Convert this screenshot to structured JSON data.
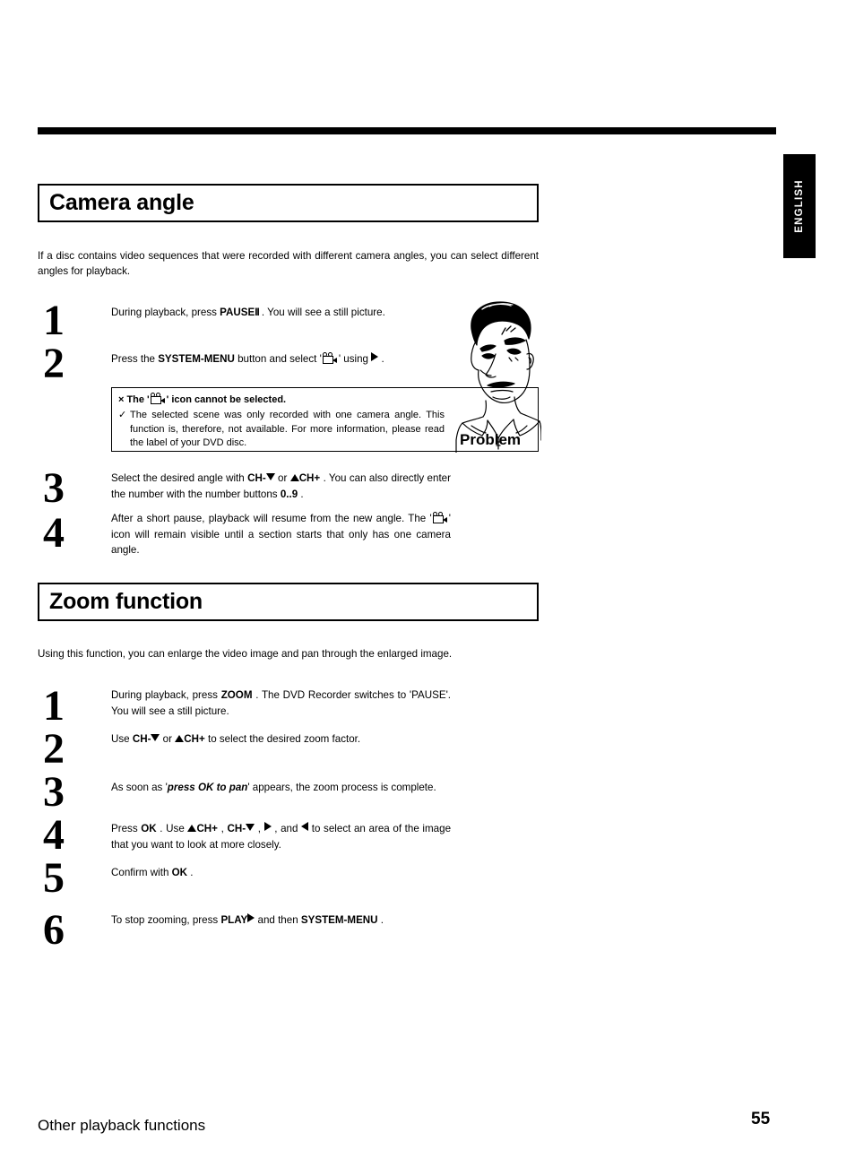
{
  "document": {
    "language_tab": "ENGLISH",
    "footer_section": "Other playback functions",
    "page_number": "55"
  },
  "sections": [
    {
      "id": "camera-angle",
      "heading": "Camera angle",
      "intro": "If a disc contains video sequences that were recorded with different camera angles, you can select different angles for playback.",
      "steps": [
        {
          "number": "1",
          "segments": [
            {
              "t": "text",
              "v": "During playback, press "
            },
            {
              "t": "key",
              "v": "PAUSE"
            },
            {
              "t": "pause-icon",
              "v": "II"
            },
            {
              "t": "text",
              "v": " . You will see a still picture."
            }
          ]
        },
        {
          "number": "2",
          "segments": [
            {
              "t": "text",
              "v": "Press the "
            },
            {
              "t": "key",
              "v": "SYSTEM-MENU"
            },
            {
              "t": "text",
              "v": " button and select '"
            },
            {
              "t": "camera-icon",
              "v": "camera-angle-icon"
            },
            {
              "t": "text",
              "v": "' using "
            },
            {
              "t": "arrow-right",
              "v": "▶"
            },
            {
              "t": "text",
              "v": " ."
            }
          ]
        },
        {
          "number": "3",
          "segments": [
            {
              "t": "text",
              "v": "Select the desired angle with "
            },
            {
              "t": "key",
              "v": "CH-"
            },
            {
              "t": "arrow-down",
              "v": "▼"
            },
            {
              "t": "text",
              "v": " or "
            },
            {
              "t": "arrow-up",
              "v": "▲"
            },
            {
              "t": "key",
              "v": "CH+"
            },
            {
              "t": "text",
              "v": " . You can also directly enter the number with the number buttons "
            },
            {
              "t": "key",
              "v": "0..9"
            },
            {
              "t": "text",
              "v": " ."
            }
          ]
        },
        {
          "number": "4",
          "segments": [
            {
              "t": "text",
              "v": "After a short pause, playback will resume from the new angle. The '"
            },
            {
              "t": "camera-icon",
              "v": "camera-angle-icon"
            },
            {
              "t": "text",
              "v": "' icon will remain visible until a section starts that only has one camera angle."
            }
          ]
        }
      ],
      "notice": {
        "problem_bullet": "×",
        "problem_prefix": "The '",
        "problem_icon": "camera-angle-icon",
        "problem_suffix": "' icon cannot be selected.",
        "solution_bullet": "✓",
        "solution_text": "The selected scene was only recorded with one camera angle. This function is, therefore, not available. For more information, please read the label of your DVD disc."
      },
      "illustration_label": "Problem",
      "illustration_name": "frustrated-man-drawing"
    },
    {
      "id": "zoom-function",
      "heading": "Zoom function",
      "intro": "Using this function, you can enlarge the video image and pan through the enlarged image.",
      "steps": [
        {
          "number": "1",
          "segments": [
            {
              "t": "text",
              "v": "During playback, press "
            },
            {
              "t": "key",
              "v": "ZOOM"
            },
            {
              "t": "text",
              "v": " . The DVD Recorder switches to 'PAUSE'. You will see a still picture."
            }
          ]
        },
        {
          "number": "2",
          "segments": [
            {
              "t": "text",
              "v": "Use "
            },
            {
              "t": "key",
              "v": "CH-"
            },
            {
              "t": "arrow-down",
              "v": "▼"
            },
            {
              "t": "text",
              "v": " or "
            },
            {
              "t": "arrow-up",
              "v": "▲"
            },
            {
              "t": "key",
              "v": "CH+"
            },
            {
              "t": "text",
              "v": " to select the desired zoom factor."
            }
          ]
        },
        {
          "number": "3",
          "segments": [
            {
              "t": "text",
              "v": "As soon as '"
            },
            {
              "t": "emph",
              "v": "press OK to pan"
            },
            {
              "t": "text",
              "v": "' appears, the zoom process is complete."
            }
          ]
        },
        {
          "number": "4",
          "segments": [
            {
              "t": "text",
              "v": "Press "
            },
            {
              "t": "key",
              "v": "OK"
            },
            {
              "t": "text",
              "v": " . Use "
            },
            {
              "t": "arrow-up",
              "v": "▲"
            },
            {
              "t": "key",
              "v": "CH+"
            },
            {
              "t": "text",
              "v": " , "
            },
            {
              "t": "key",
              "v": "CH-"
            },
            {
              "t": "arrow-down",
              "v": "▼"
            },
            {
              "t": "text",
              "v": " , "
            },
            {
              "t": "arrow-right",
              "v": "▶"
            },
            {
              "t": "text",
              "v": " , and "
            },
            {
              "t": "arrow-left",
              "v": "◀"
            },
            {
              "t": "text",
              "v": " to select an area of the image that you want to look at more closely."
            }
          ]
        },
        {
          "number": "5",
          "segments": [
            {
              "t": "text",
              "v": "Confirm with "
            },
            {
              "t": "key",
              "v": "OK"
            },
            {
              "t": "text",
              "v": " ."
            }
          ]
        },
        {
          "number": "6",
          "segments": [
            {
              "t": "text",
              "v": "To stop zooming, press "
            },
            {
              "t": "key",
              "v": "PLAY"
            },
            {
              "t": "arrow-right",
              "v": "▶"
            },
            {
              "t": "text",
              "v": " and then "
            },
            {
              "t": "key",
              "v": "SYSTEM-MENU"
            },
            {
              "t": "text",
              "v": " ."
            }
          ]
        }
      ]
    }
  ],
  "layout": {
    "camera_step_tops": [
      340,
      392,
      525,
      570
    ],
    "camera_num_tops": [
      335,
      383,
      522,
      572
    ],
    "zoom_step_tops": [
      767,
      816,
      870,
      916,
      965,
      1018
    ],
    "zoom_num_tops": [
      765,
      813,
      861,
      909,
      957,
      1015
    ]
  },
  "colors": {
    "ink": "#000000",
    "paper": "#ffffff"
  }
}
